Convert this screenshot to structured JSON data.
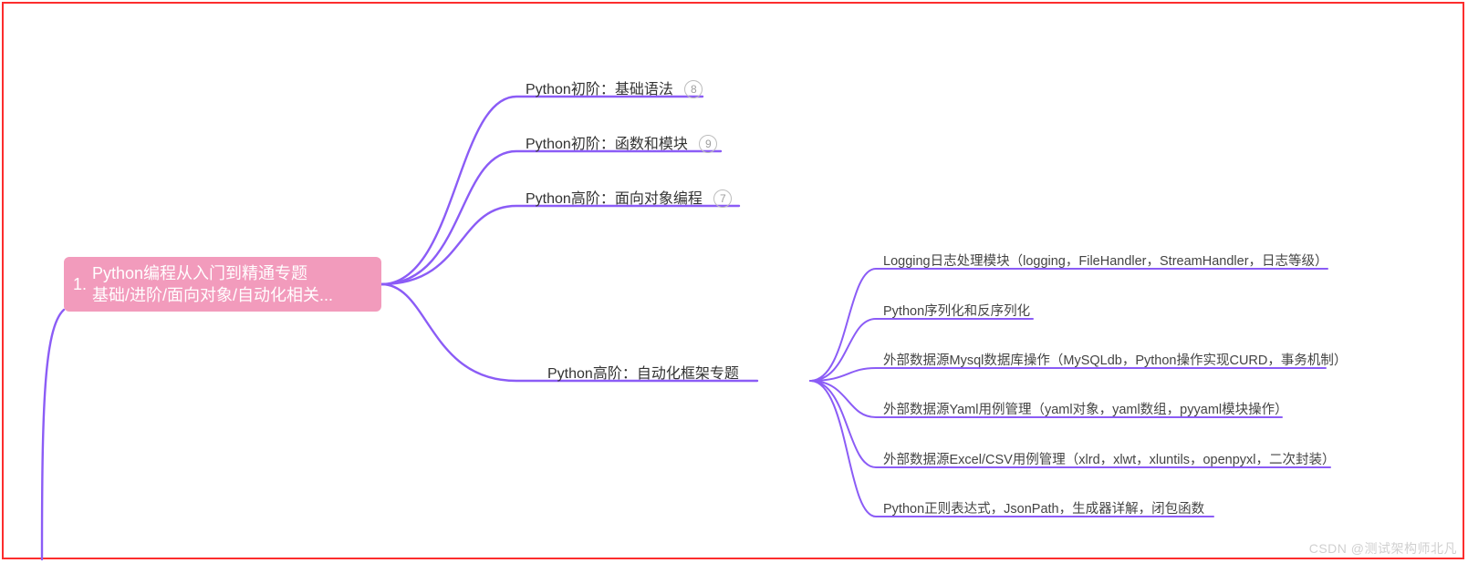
{
  "root": {
    "number": "1.",
    "title_line1": "Python编程从入门到精通专题",
    "title_line2": "基础/进阶/面向对象/自动化相关...",
    "color": "#f29bbc"
  },
  "branch": {
    "color": "#8b5cf6",
    "nodes": [
      {
        "id": "n1",
        "label": "Python初阶：基础语法",
        "badge": "8"
      },
      {
        "id": "n2",
        "label": "Python初阶：函数和模块",
        "badge": "9"
      },
      {
        "id": "n3",
        "label": "Python高阶：面向对象编程",
        "badge": "7"
      },
      {
        "id": "n4",
        "label": "Python高阶：自动化框架专题",
        "badge": null,
        "children": [
          {
            "id": "s1",
            "label": "Logging日志处理模块（logging，FileHandler，StreamHandler，日志等级）"
          },
          {
            "id": "s2",
            "label": "Python序列化和反序列化"
          },
          {
            "id": "s3",
            "label": "外部数据源Mysql数据库操作（MySQLdb，Python操作实现CURD，事务机制）"
          },
          {
            "id": "s4",
            "label": "外部数据源Yaml用例管理（yaml对象，yaml数组，pyyaml模块操作）"
          },
          {
            "id": "s5",
            "label": "外部数据源Excel/CSV用例管理（xlrd，xlwt，xluntils，openpyxl，二次封装）"
          },
          {
            "id": "s6",
            "label": "Python正则表达式，JsonPath，生成器详解，闭包函数"
          }
        ]
      }
    ]
  },
  "watermark": "CSDN @测试架构师北凡",
  "chart_data": {
    "type": "mindmap",
    "root": {
      "label": "1. Python编程从入门到精通专题 基础/进阶/面向对象/自动化相关...",
      "children": [
        {
          "label": "Python初阶：基础语法",
          "count": 8
        },
        {
          "label": "Python初阶：函数和模块",
          "count": 9
        },
        {
          "label": "Python高阶：面向对象编程",
          "count": 7
        },
        {
          "label": "Python高阶：自动化框架专题",
          "children": [
            {
              "label": "Logging日志处理模块（logging，FileHandler，StreamHandler，日志等级）"
            },
            {
              "label": "Python序列化和反序列化"
            },
            {
              "label": "外部数据源Mysql数据库操作（MySQLdb，Python操作实现CURD，事务机制）"
            },
            {
              "label": "外部数据源Yaml用例管理（yaml对象，yaml数组，pyyaml模块操作）"
            },
            {
              "label": "外部数据源Excel/CSV用例管理（xlrd，xlwt，xluntils，openpyxl，二次封装）"
            },
            {
              "label": "Python正则表达式，JsonPath，生成器详解，闭包函数"
            }
          ]
        }
      ]
    }
  }
}
